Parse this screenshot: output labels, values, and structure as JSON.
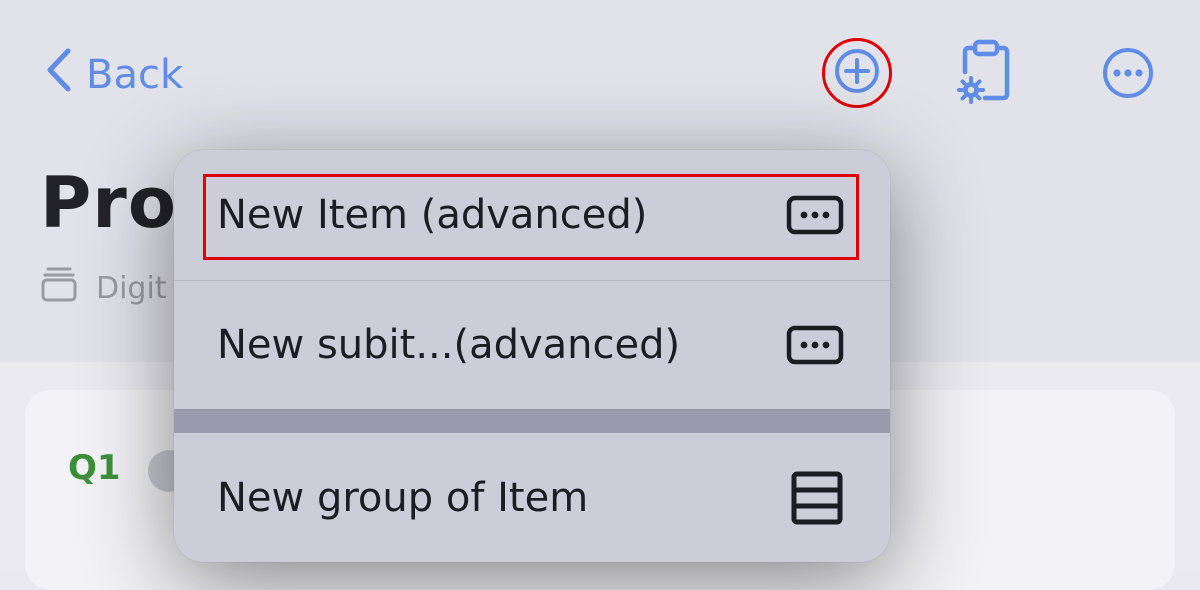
{
  "navbar": {
    "back_label": "Back",
    "back_icon": "chevron-left-icon",
    "actions": [
      {
        "name": "add",
        "icon": "plus-circle-icon"
      },
      {
        "name": "clipboard-settings",
        "icon": "clipboard-gear-icon"
      },
      {
        "name": "more",
        "icon": "ellipsis-circle-icon"
      }
    ]
  },
  "page": {
    "title": "Pro",
    "subtitle": "Digit",
    "subtitle_icon": "stack-icon"
  },
  "group": {
    "label": "Q1",
    "toggle_icon": "chevron-down-icon"
  },
  "menu": {
    "items": [
      {
        "label": "New Item (advanced)",
        "icon": "ellipsis-rectangle-icon"
      },
      {
        "label": "New subit...(advanced)",
        "icon": "ellipsis-rectangle-icon"
      },
      {
        "label": "New group of Item",
        "icon": "rows-icon"
      }
    ]
  },
  "colors": {
    "accent": "#5f8ce6",
    "highlight": "#e00000",
    "group_label": "#3f8f3a",
    "menu_bg": "#cdccd9"
  }
}
